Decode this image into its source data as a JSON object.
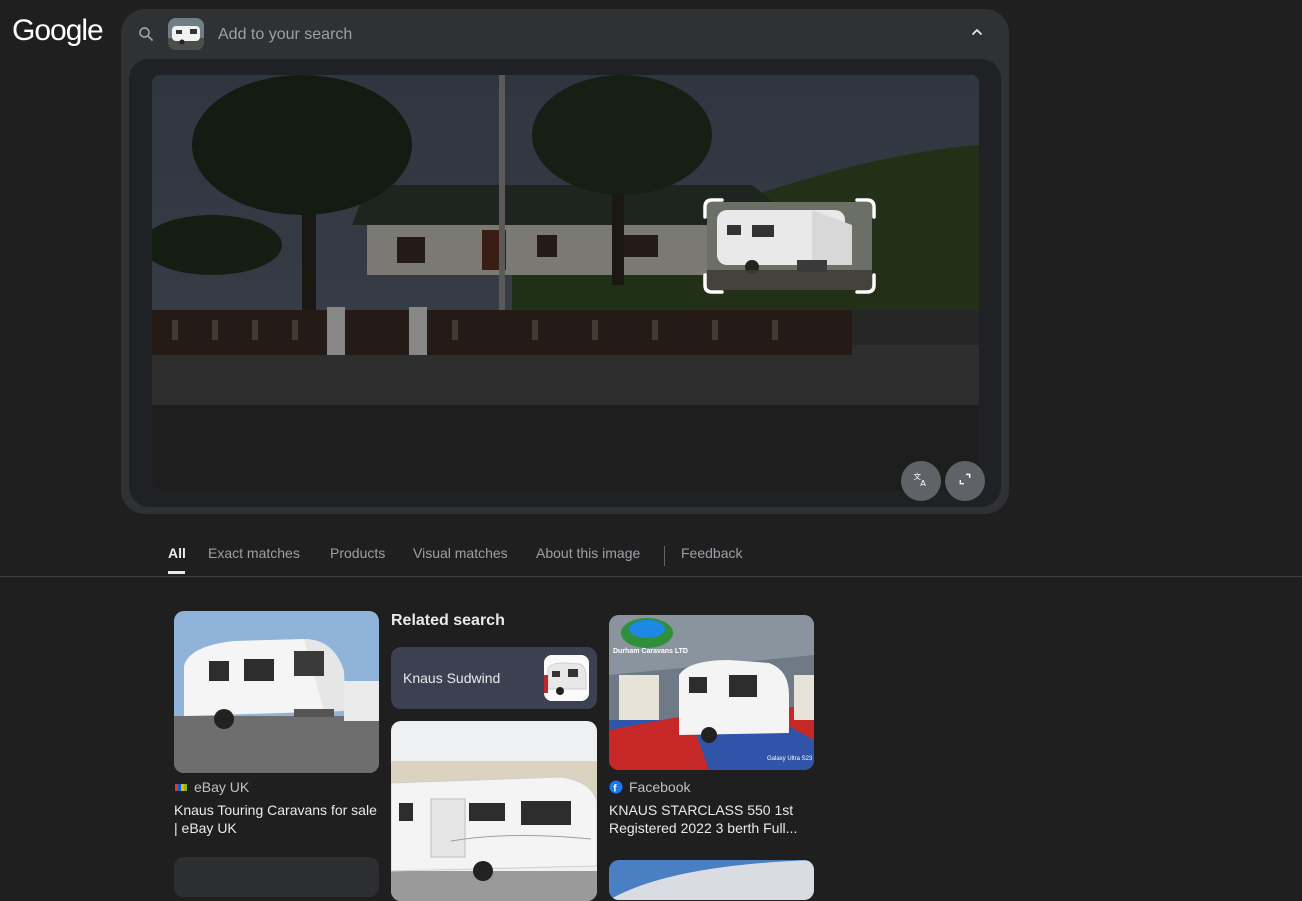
{
  "logo": {
    "text": "Google"
  },
  "search": {
    "placeholder": "Add to your search",
    "search_icon": "search-icon",
    "collapse_icon": "chevron-up-icon"
  },
  "image_controls": {
    "translate_icon": "translate-icon",
    "fullscreen_icon": "fullscreen-icon"
  },
  "tabs": [
    {
      "label": "All",
      "active": true
    },
    {
      "label": "Exact matches"
    },
    {
      "label": "Products"
    },
    {
      "label": "Visual matches"
    },
    {
      "label": "About this image"
    },
    {
      "label": "Feedback"
    }
  ],
  "results": {
    "left_card": {
      "source": "eBay UK",
      "source_icon": "ebay-icon",
      "title": "Knaus Touring Caravans for sale | eBay UK"
    },
    "related": {
      "heading": "Related search",
      "chip_label": "Knaus Sudwind"
    },
    "right_card": {
      "source": "Facebook",
      "source_icon": "facebook-icon",
      "title": "KNAUS STARCLASS 550 1st Registered 2022 3 berth Full...",
      "logo_text": "Durham Caravans LTD",
      "caption": "Galaxy Ultra S23"
    }
  },
  "colors": {
    "background": "#1f1f1f",
    "panel": "#303134",
    "accent_text": "#e8eaed",
    "muted_text": "#9aa0a6",
    "facebook_blue": "#1877f2"
  }
}
